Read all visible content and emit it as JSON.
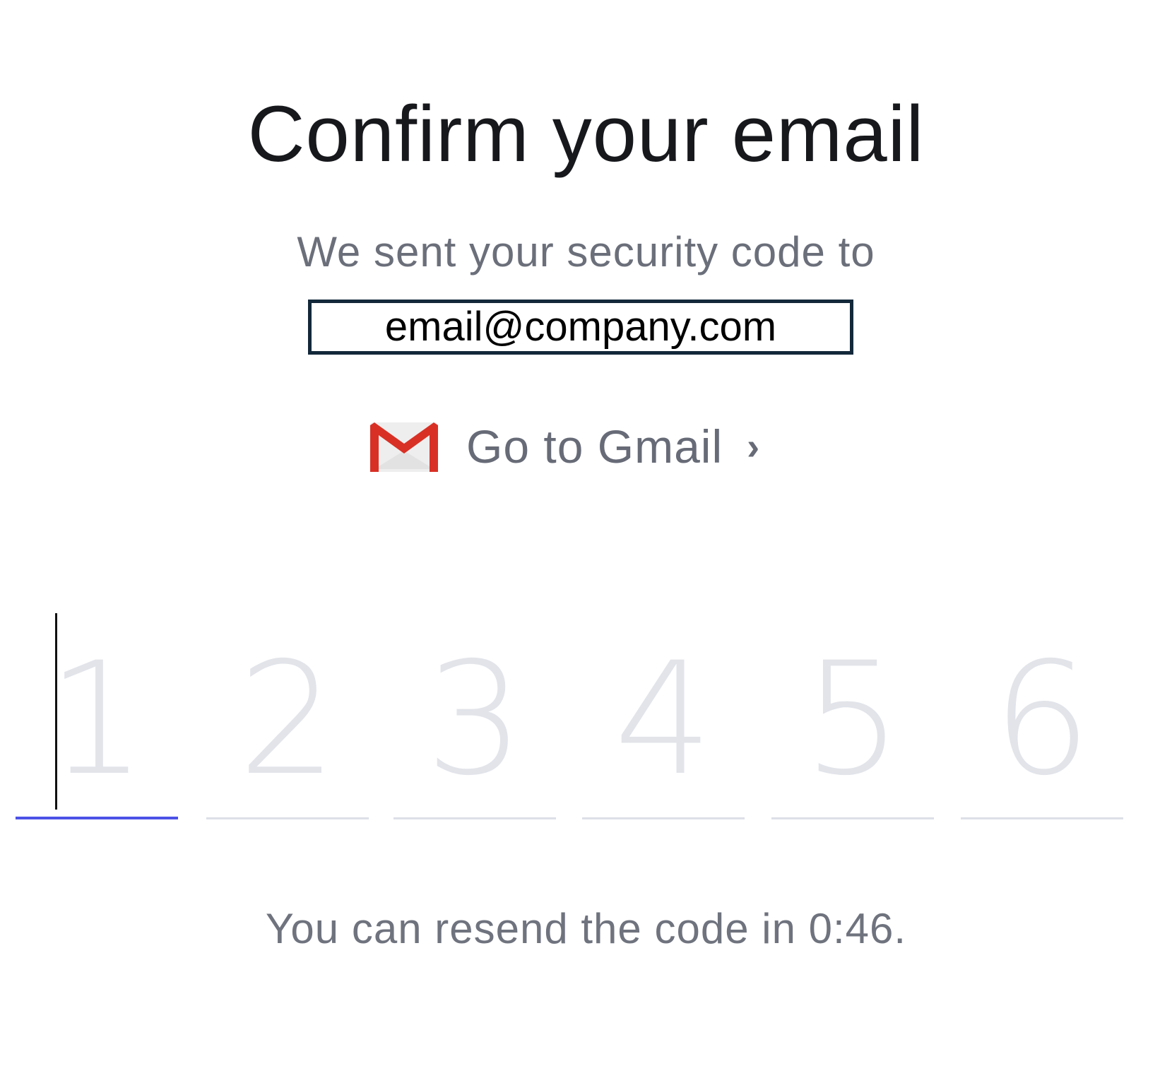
{
  "title": "Confirm your email",
  "subtitle": "We sent your security code to",
  "email": "email@company.com",
  "gmail_link": {
    "label": "Go to Gmail",
    "chevron": "›",
    "icon": "gmail-icon"
  },
  "code_inputs": [
    {
      "placeholder": "1",
      "value": ""
    },
    {
      "placeholder": "2",
      "value": ""
    },
    {
      "placeholder": "3",
      "value": ""
    },
    {
      "placeholder": "4",
      "value": ""
    },
    {
      "placeholder": "5",
      "value": ""
    },
    {
      "placeholder": "6",
      "value": ""
    }
  ],
  "resend_text": "You can resend the code in 0:46.",
  "colors": {
    "title": "#17181c",
    "muted_text": "#6b6f7a",
    "active_underline": "#4b52e6",
    "inactive_underline": "#dddfe8",
    "placeholder_digit": "#e2e4ea",
    "email_box_border": "#13283a",
    "gmail_red": "#d93025"
  }
}
